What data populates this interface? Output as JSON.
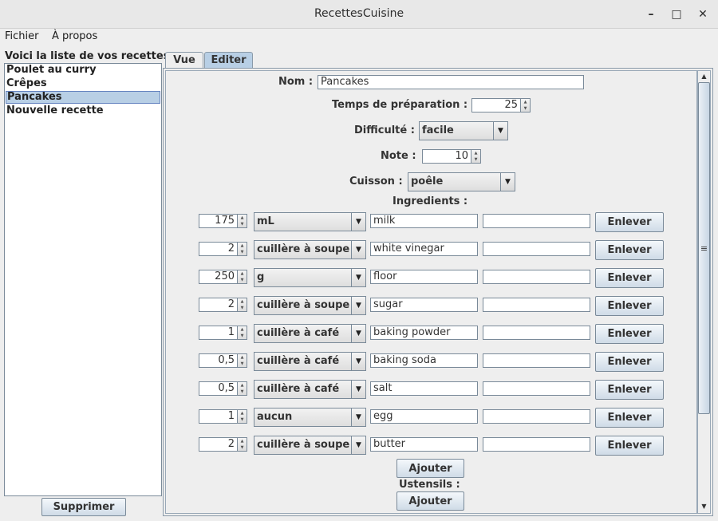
{
  "window": {
    "title": "RecettesCuisine",
    "minimize": "–",
    "maximize": "□",
    "close": "✕"
  },
  "menu": {
    "fichier": "Fichier",
    "apropos": "À propos"
  },
  "sidebar": {
    "caption": "Voici la liste de vos recettes :",
    "recipes": [
      "Poulet au curry",
      "Crêpes",
      "Pancakes",
      "Nouvelle recette"
    ],
    "selected": "Pancakes",
    "delete_button": "Supprimer"
  },
  "tabs": {
    "vue": "Vue",
    "editer": "Editer",
    "active": "Editer"
  },
  "form": {
    "nom_label": "Nom :",
    "nom_value": "Pancakes",
    "temps_label": "Temps de préparation :",
    "temps_value": "25",
    "difficulte_label": "Difficulté :",
    "difficulte_value": "facile",
    "note_label": "Note :",
    "note_value": "10",
    "cuisson_label": "Cuisson :",
    "cuisson_value": "poêle",
    "ingredients_label": "Ingredients :",
    "ingredients": [
      {
        "qty": "175",
        "unit": "mL",
        "name": "milk",
        "extra": "",
        "remove": "Enlever"
      },
      {
        "qty": "2",
        "unit": "cuillère à soupe",
        "name": "white vinegar",
        "extra": "",
        "remove": "Enlever"
      },
      {
        "qty": "250",
        "unit": "g",
        "name": "floor",
        "extra": "",
        "remove": "Enlever"
      },
      {
        "qty": "2",
        "unit": "cuillère à soupe",
        "name": "sugar",
        "extra": "",
        "remove": "Enlever"
      },
      {
        "qty": "1",
        "unit": "cuillère à café",
        "name": "baking powder",
        "extra": "",
        "remove": "Enlever"
      },
      {
        "qty": "0,5",
        "unit": "cuillère à café",
        "name": "baking soda",
        "extra": "",
        "remove": "Enlever"
      },
      {
        "qty": "0,5",
        "unit": "cuillère à café",
        "name": "salt",
        "extra": "",
        "remove": "Enlever"
      },
      {
        "qty": "1",
        "unit": "aucun",
        "name": "egg",
        "extra": "",
        "remove": "Enlever"
      },
      {
        "qty": "2",
        "unit": "cuillère à soupe",
        "name": "butter",
        "extra": "",
        "remove": "Enlever"
      }
    ],
    "add_ingredient": "Ajouter",
    "ustensils_label": "Ustensils :",
    "add_ustensil": "Ajouter"
  },
  "icons": {
    "spin_up": "▲",
    "spin_down": "▼",
    "combo_arrow": "▼",
    "scroll_up": "▲",
    "scroll_down": "▼",
    "scroll_grip": "≡"
  },
  "colors": {
    "selection": "#b8cfe5",
    "background": "#eeeeee",
    "border": "#7a8a99"
  }
}
